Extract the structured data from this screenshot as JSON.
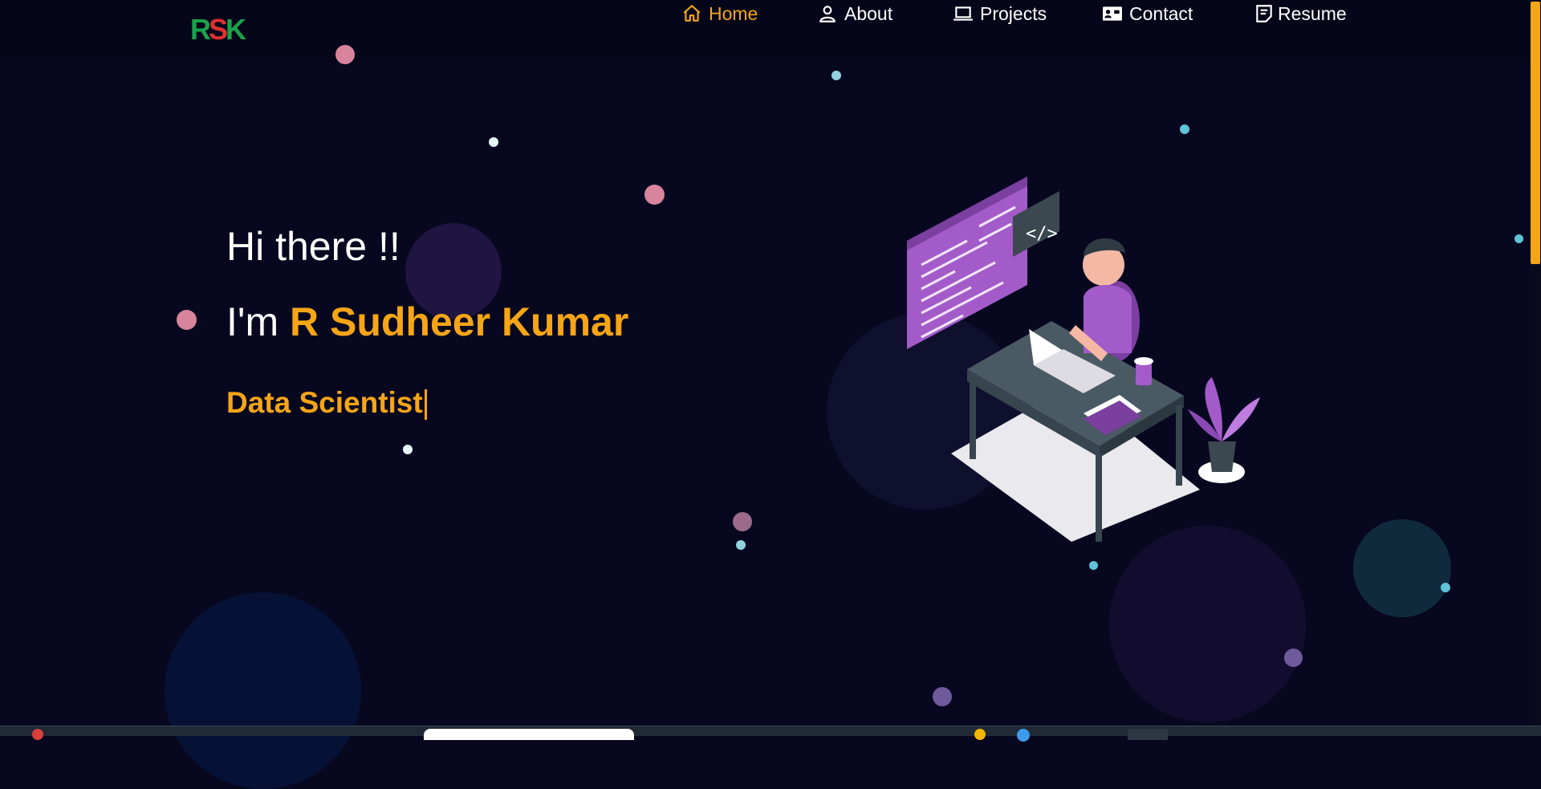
{
  "logo": {
    "r": "R",
    "s": "S",
    "k": "K"
  },
  "nav": {
    "home": {
      "label": "Home",
      "icon": "home-icon"
    },
    "about": {
      "label": "About",
      "icon": "user-icon"
    },
    "projects": {
      "label": "Projects",
      "icon": "laptop-icon"
    },
    "contact": {
      "label": "Contact",
      "icon": "contact-card-icon"
    },
    "resume": {
      "label": "Resume",
      "icon": "document-icon"
    }
  },
  "hero": {
    "greeting": "Hi there !!",
    "intro_prefix": "I'm",
    "name": "R Sudheer Kumar",
    "role": "Data Scientist"
  },
  "illustration": {
    "code_badge": "</>"
  },
  "colors": {
    "accent": "#f6a516",
    "background": "#070720",
    "logo_green": "#1aa34a",
    "logo_red": "#e0302e",
    "purple": "#a35bc9"
  }
}
